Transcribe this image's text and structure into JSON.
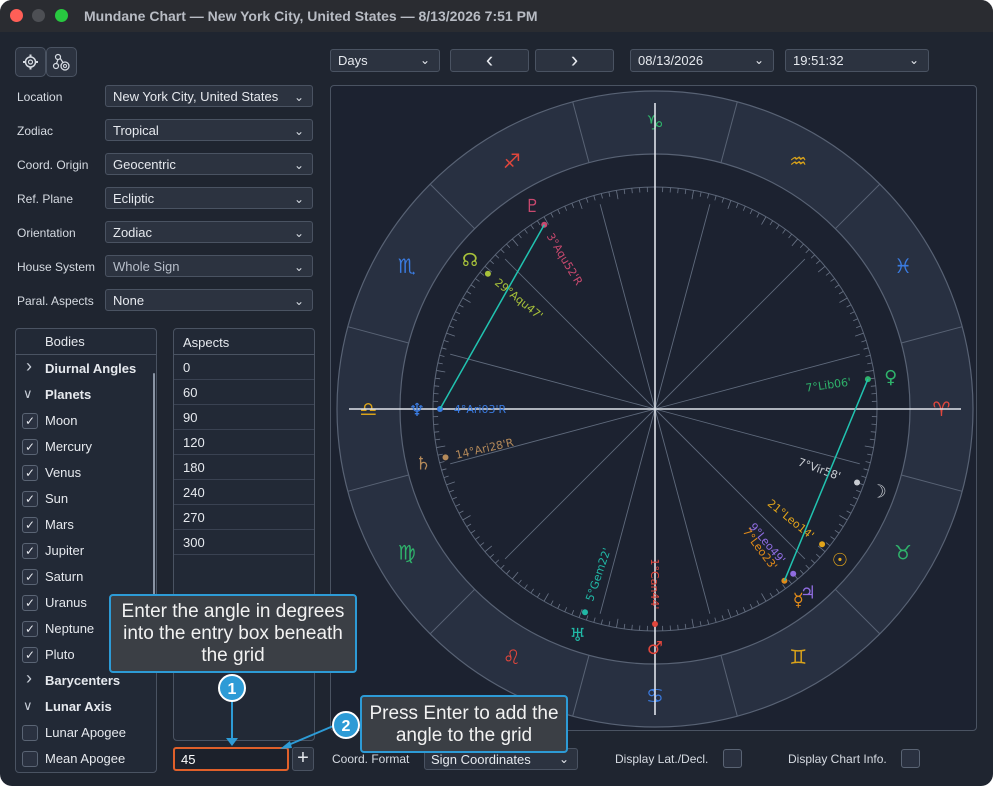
{
  "window": {
    "title": "Mundane Chart — New York City, United States — 8/13/2026 7:51 PM"
  },
  "settings": [
    {
      "label": "Location",
      "value": "New York City, United States"
    },
    {
      "label": "Zodiac",
      "value": "Tropical"
    },
    {
      "label": "Coord. Origin",
      "value": "Geocentric"
    },
    {
      "label": "Ref. Plane",
      "value": "Ecliptic"
    },
    {
      "label": "Orientation",
      "value": "Zodiac"
    },
    {
      "label": "House System",
      "value": "Whole Sign"
    },
    {
      "label": "Paral. Aspects",
      "value": "None"
    }
  ],
  "bodies": {
    "header": "Bodies",
    "rows": [
      {
        "label": "Diurnal Angles"
      },
      {
        "label": "Planets"
      },
      {
        "label": "Moon",
        "check": "✓"
      },
      {
        "label": "Mercury",
        "check": "✓"
      },
      {
        "label": "Venus",
        "check": "✓"
      },
      {
        "label": "Sun",
        "check": "✓"
      },
      {
        "label": "Mars",
        "check": "✓"
      },
      {
        "label": "Jupiter",
        "check": "✓"
      },
      {
        "label": "Saturn",
        "check": "✓"
      },
      {
        "label": "Uranus",
        "check": "✓"
      },
      {
        "label": "Neptune",
        "check": "✓"
      },
      {
        "label": "Pluto",
        "check": "✓"
      },
      {
        "label": "Barycenters"
      },
      {
        "label": "Lunar Axis"
      },
      {
        "label": "Lunar Apogee",
        "check": ""
      },
      {
        "label": "Mean Apogee",
        "check": ""
      }
    ]
  },
  "aspects": {
    "header": "Aspects",
    "values": [
      "0",
      "60",
      "90",
      "120",
      "180",
      "240",
      "270",
      "300"
    ]
  },
  "angle_input": {
    "value": "45",
    "add_label": "+"
  },
  "toolbar": {
    "step": "Days",
    "prev": "‹",
    "next": "›",
    "date": "08/13/2026",
    "time": "19:51:32"
  },
  "bottom": {
    "coord_format_label": "Coord. Format",
    "coord_format_value": "Sign Coordinates",
    "display_lat_label": "Display Lat./Decl.",
    "display_info_label": "Display Chart Info."
  },
  "callouts": {
    "one": {
      "text": "Enter the angle in degrees into the entry box beneath the grid",
      "number": "1"
    },
    "two": {
      "text": "Press Enter to add the angle to the grid",
      "number": "2"
    }
  },
  "chart": {
    "signs": [
      "♑",
      "♐",
      "♏",
      "♎",
      "♍",
      "♌",
      "♋",
      "♊",
      "♉",
      "♈",
      "♓",
      "♒"
    ],
    "sign_colors": [
      "#2fb36b",
      "#e0463c",
      "#3a7be0",
      "#d9a21a",
      "#2fb36b",
      "#e0463c",
      "#3a7be0",
      "#d9a21a",
      "#2fb36b",
      "#e0463c",
      "#3a7be0",
      "#d9a21a"
    ],
    "planets": [
      {
        "name": "Pluto",
        "glyph": "♇",
        "label": "3°Aqu52'R",
        "color": "#c9496f"
      },
      {
        "name": "Lunar Node",
        "glyph": "☊",
        "label": "29°Aqu47'",
        "color": "#a8c23a"
      },
      {
        "name": "Neptune",
        "glyph": "♆",
        "label": "4°Ari03'R",
        "color": "#3a7be0"
      },
      {
        "name": "Saturn",
        "glyph": "♄",
        "label": "14°Ari28'R",
        "color": "#b58a5a"
      },
      {
        "name": "Venus",
        "glyph": "♀",
        "label": "7°Lib06'",
        "color": "#2fb36b"
      },
      {
        "name": "Moon",
        "glyph": "☽",
        "label": "7°Vir58'",
        "color": "#c8ccd2"
      },
      {
        "name": "Sun",
        "glyph": "☉",
        "label": "21°Leo14'",
        "color": "#e3a51a"
      },
      {
        "name": "Jupiter",
        "glyph": "♃",
        "label": "9°Leo49'",
        "color": "#8f6ce0"
      },
      {
        "name": "Mercury",
        "glyph": "☿",
        "label": "7°Leo23'",
        "color": "#e08a1a"
      },
      {
        "name": "Uranus",
        "glyph": "♅",
        "label": "5°Gem22'",
        "color": "#21b8a6"
      },
      {
        "name": "Mars",
        "glyph": "♂",
        "label": "1°Can44'",
        "color": "#e0463c"
      }
    ]
  }
}
